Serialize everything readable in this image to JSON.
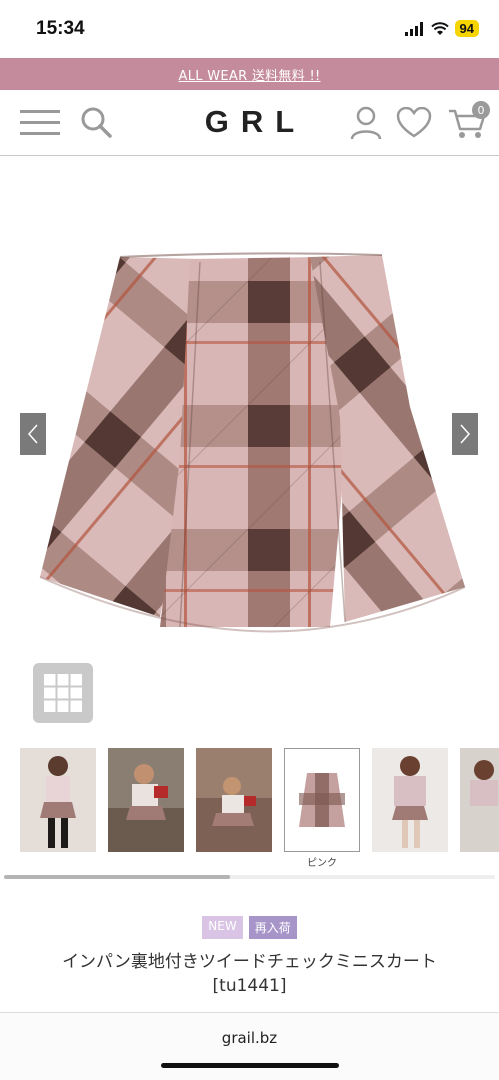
{
  "status_bar": {
    "time": "15:34",
    "battery": "94"
  },
  "promo": {
    "text": "ALL WEAR 送料無料 !!"
  },
  "header": {
    "logo": "GRL",
    "cart_count": "0"
  },
  "gallery": {
    "current_color_caption": "ピンク"
  },
  "product": {
    "badges": {
      "new": "NEW",
      "restock": "再入荷"
    },
    "title_line1": "インパン裏地付きツイードチェックミニスカート",
    "title_line2": "[tu1441]"
  },
  "browser": {
    "url": "grail.bz"
  },
  "colors": {
    "accent": "#c48b9c",
    "badge_new": "#d9c4e6",
    "badge_restock": "#a795c9"
  }
}
